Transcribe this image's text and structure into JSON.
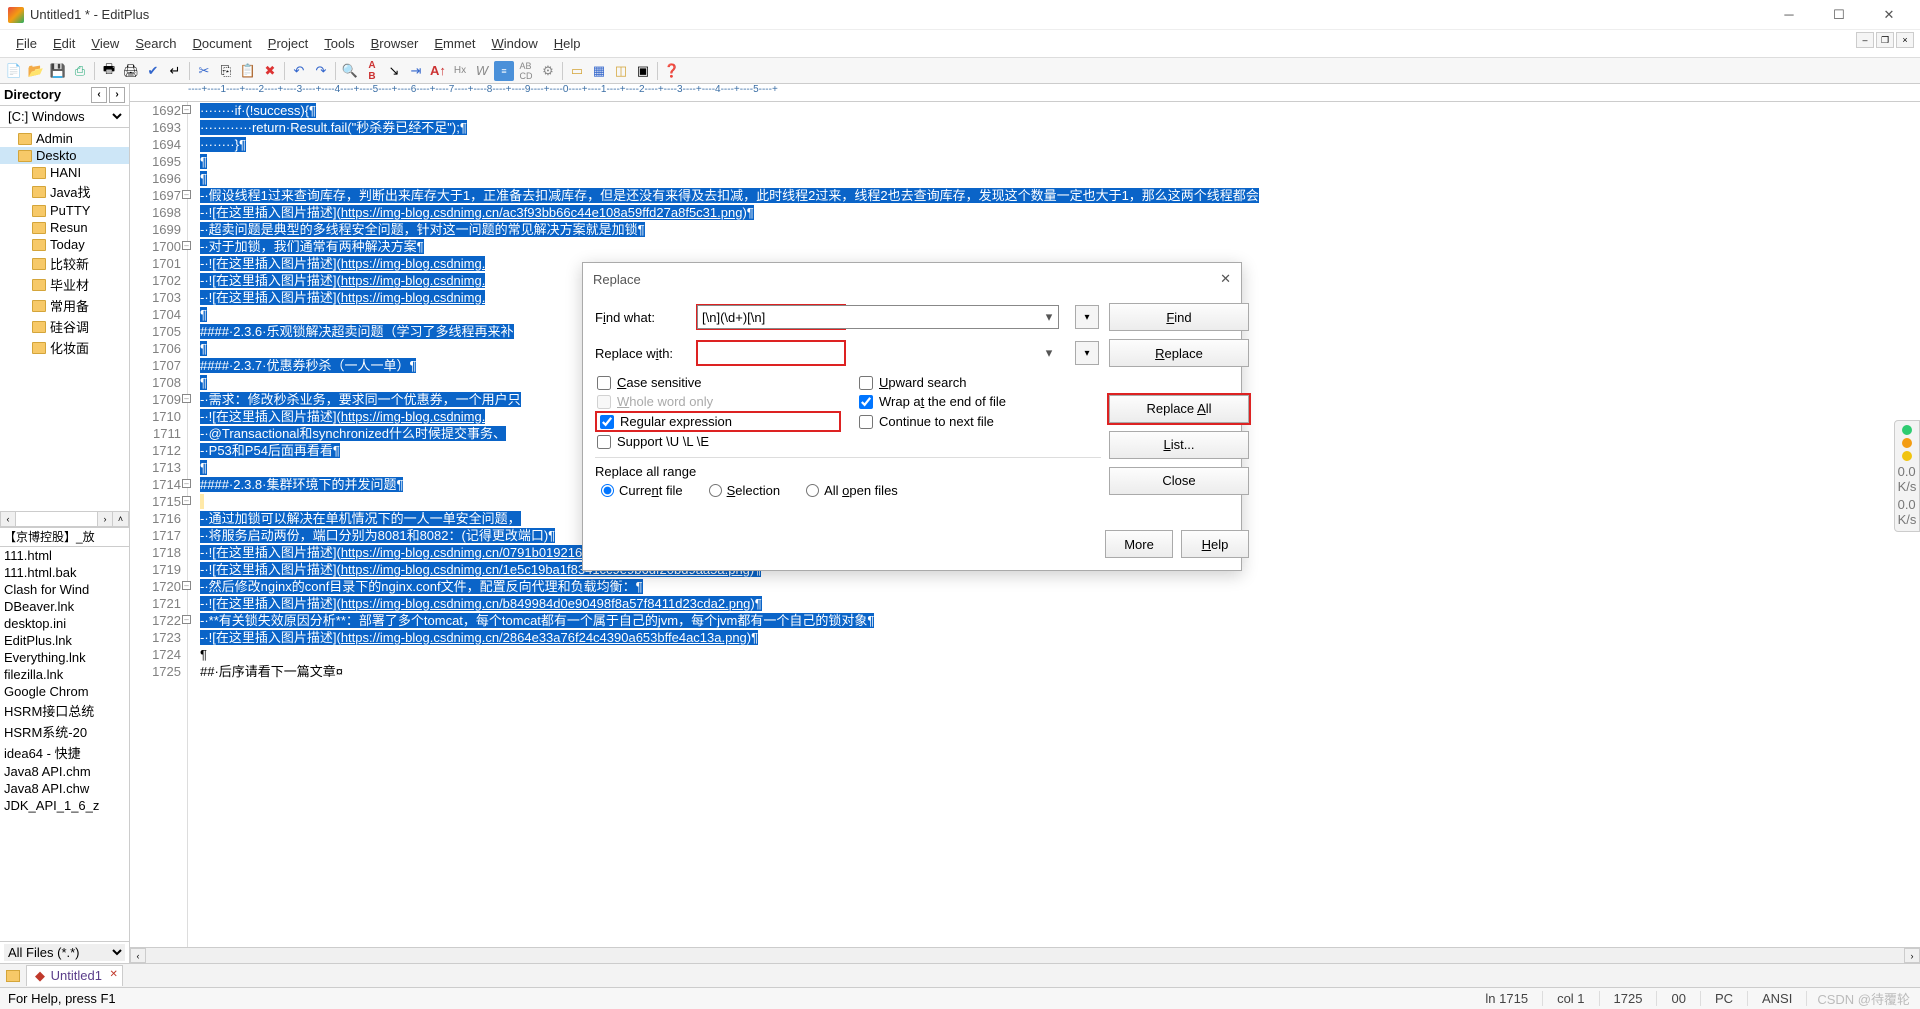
{
  "title": "Untitled1 * - EditPlus",
  "menu": [
    "File",
    "Edit",
    "View",
    "Search",
    "Document",
    "Project",
    "Tools",
    "Browser",
    "Emmet",
    "Window",
    "Help"
  ],
  "side": {
    "directory_label": "Directory",
    "drive": "[C:] Windows",
    "tree": [
      {
        "label": "Admin",
        "indent": 1
      },
      {
        "label": "Deskto",
        "indent": 1,
        "selected": true
      },
      {
        "label": "HANI",
        "indent": 2
      },
      {
        "label": "Java找",
        "indent": 2
      },
      {
        "label": "PuTTY",
        "indent": 2
      },
      {
        "label": "Resun",
        "indent": 2
      },
      {
        "label": "Today",
        "indent": 2
      },
      {
        "label": "比较新",
        "indent": 2
      },
      {
        "label": "毕业材",
        "indent": 2
      },
      {
        "label": "常用备",
        "indent": 2
      },
      {
        "label": "硅谷调",
        "indent": 2
      },
      {
        "label": "化妆面",
        "indent": 2
      }
    ],
    "filelist_header": "【京博控股】_放",
    "files": [
      "111.html",
      "111.html.bak",
      "Clash for Wind",
      "DBeaver.lnk",
      "desktop.ini",
      "EditPlus.lnk",
      "Everything.lnk",
      "filezilla.lnk",
      "Google Chrom",
      "HSRM接口总统",
      "HSRM系统-20",
      "idea64 - 快捷",
      "Java8 API.chm",
      "Java8 API.chw",
      "JDK_API_1_6_z"
    ],
    "filter": "All Files (*.*)"
  },
  "ruler_text": "----+----1----+----2----+----3----+----4----+----5----+----6----+----7----+----8----+----9----+----0----+----1----+----2----+----3----+----4----+----5----+",
  "lines_start": 1692,
  "code": [
    "········if·(!success){¶",
    "············return·Result.fail(\"秒杀券已经不足\");¶",
    "········}¶",
    "¶",
    "¶",
    "-·假设线程1过来查询库存，判断出来库存大于1，正准备去扣减库存，但是还没有来得及去扣减，此时线程2过来，线程2也去查询库存，发现这个数量一定也大于1，那么这两个线程都会",
    "-·![在这里插入图片描述](https://img-blog.csdnimg.cn/ac3f93bb66c44e108a59ffd27a8f5c31.png)¶",
    "-·超卖问题是典型的多线程安全问题，针对这一问题的常见解决方案就是加锁¶",
    "-·对于加锁，我们通常有两种解决方案¶",
    "-·![在这里插入图片描述](https://img-blog.csdnimg.",
    "-·![在这里插入图片描述](https://img-blog.csdnimg.",
    "-·![在这里插入图片描述](https://img-blog.csdnimg.",
    "¶",
    "####·2.3.6·乐观锁解决超卖问题（学习了多线程再来补",
    "¶",
    "####·2.3.7·优惠券秒杀（一人一单）¶",
    "¶",
    "-·需求：修改秒杀业务，要求同一个优惠券，一个用户只",
    "-·![在这里插入图片描述](https://img-blog.csdnimg.",
    "-·@Transactional和synchronized什么时候提交事务、",
    "-·P53和P54后面再看看¶",
    "¶",
    "####·2.3.8·集群环境下的并发问题¶",
    "¶",
    "-·通过加锁可以解决在单机情况下的一人一单安全问题，",
    "-·将服务启动两份，端口分别为8081和8082：(记得更改端口)¶",
    "-·![在这里插入图片描述](https://img-blog.csdnimg.cn/0791b01921624142be71046827759345.png)¶",
    "-·![在这里插入图片描述](https://img-blog.csdnimg.cn/1e5c19ba1f8341cc9e9b6df20bd9aa5a.png)¶",
    "-·然后修改nginx的conf目录下的nginx.conf文件，配置反向代理和负载均衡：¶",
    "-·![在这里插入图片描述](https://img-blog.csdnimg.cn/b849984d0e90498f8a57f8411d23cda2.png)¶",
    "-·**有关锁失效原因分析**：部署了多个tomcat，每个tomcat都有一个属于自己的jvm，每个jvm都有一个自己的锁对象¶",
    "-·![在这里插入图片描述](https://img-blog.csdnimg.cn/2864e33a76f24c4390a653bffe4ac13a.png)¶",
    "¶",
    "##·后序请看下一篇文章¤"
  ],
  "tab": {
    "name": "Untitled1",
    "modified": true
  },
  "status": {
    "help": "For Help, press F1",
    "ln": "ln 1715",
    "col": "col 1",
    "total": "1725",
    "mode": "00",
    "platform": "PC",
    "enc": "ANSI",
    "brand": "CSDN @待覆轮"
  },
  "sidebar_stats": {
    "down": "0.0",
    "down_unit": "K/s",
    "up": "0.0",
    "up_unit": "K/s"
  },
  "dialog": {
    "title": "Replace",
    "find_label": "Find what:",
    "find_value": "[\\n](\\d+)[\\n]",
    "replace_label": "Replace with:",
    "replace_value": "",
    "case": "Case sensitive",
    "whole": "Whole word only",
    "regex": "Regular expression",
    "support": "Support \\U \\L \\E",
    "upward": "Upward search",
    "wrap": "Wrap at the end of file",
    "continue": "Continue to next file",
    "range_title": "Replace all range",
    "r_current": "Current file",
    "r_sel": "Selection",
    "r_all": "All open files",
    "btn_find": "Find",
    "btn_replace": "Replace",
    "btn_replace_all": "Replace All",
    "btn_list": "List...",
    "btn_close": "Close",
    "btn_more": "More",
    "btn_help": "Help"
  }
}
